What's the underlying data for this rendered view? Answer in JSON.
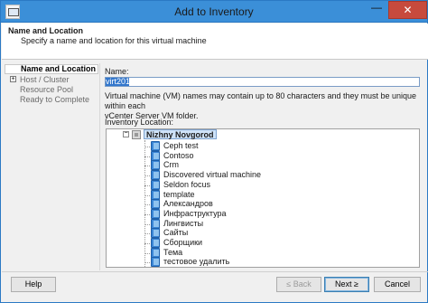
{
  "window": {
    "title": "Add to Inventory",
    "minimize_glyph": "—",
    "close_glyph": "✕"
  },
  "header": {
    "title": "Name and Location",
    "subtitle": "Specify a name and location for this virtual machine"
  },
  "steps": [
    {
      "label": "Name and Location",
      "active": true
    },
    {
      "label": "Host / Cluster",
      "expand": "+"
    },
    {
      "label": "Resource Pool"
    },
    {
      "label": "Ready to Complete"
    }
  ],
  "form": {
    "name_label": "Name:",
    "name_value": "virt201",
    "hint_line1": "Virtual machine (VM) names may contain up to 80 characters and they must be unique within each",
    "hint_line2": "vCenter Server VM folder.",
    "location_label": "Inventory Location:"
  },
  "tree": {
    "root_expand": "−",
    "root_label": "Nizhny Novgorod",
    "items": [
      "Ceph test",
      "Contoso",
      "Crm",
      "Discovered virtual machine",
      "Seldon focus",
      "template",
      "Александров",
      "Инфраструктура",
      "Лингвисты",
      "Сайты",
      "Сборщики",
      "Тема",
      "тестовое удалить"
    ]
  },
  "buttons": {
    "help": "Help",
    "back": "≤ Back",
    "next": "Next ≥",
    "cancel": "Cancel"
  },
  "colors": {
    "titlebar": "#3b8fd8",
    "close_button": "#c74a3d",
    "selection": "#cfe3f8",
    "folder": "#3b86d6"
  }
}
